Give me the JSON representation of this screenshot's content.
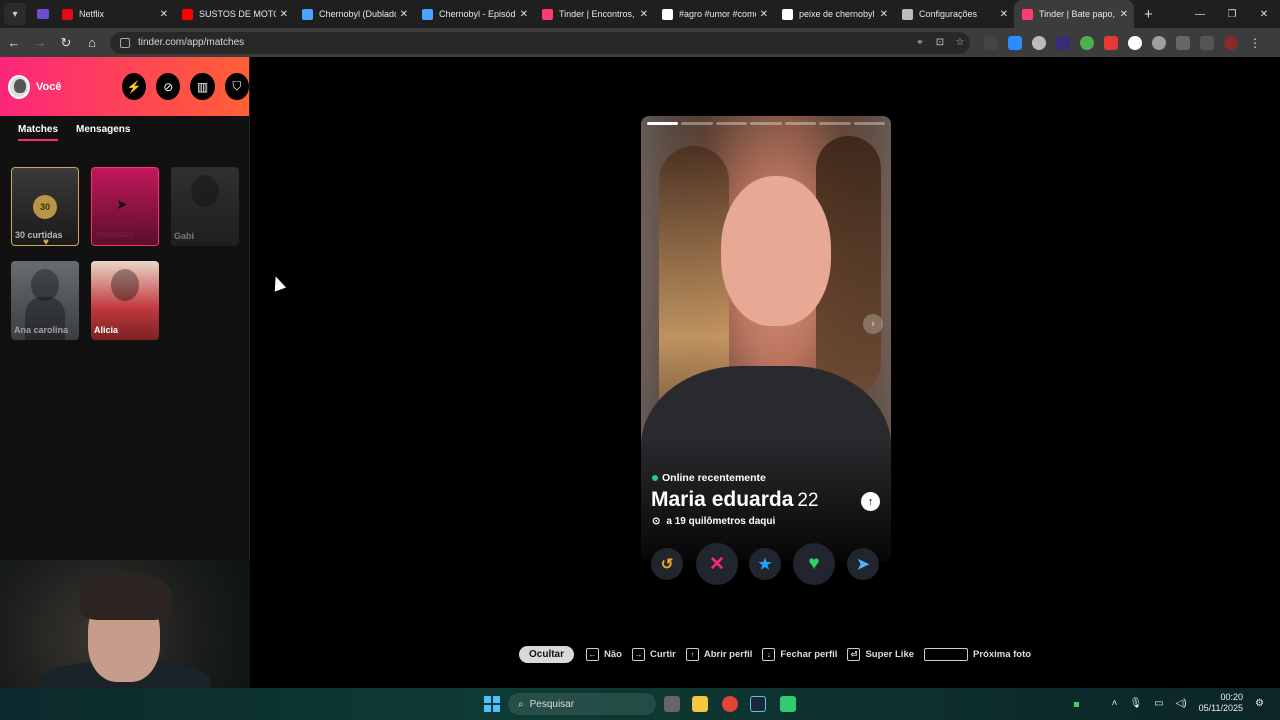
{
  "browser": {
    "tabs": [
      {
        "title": "Netflix",
        "favicon_color": "#e50914",
        "active": false
      },
      {
        "title": "SUSTOS DE MOTO (",
        "favicon_color": "#ff0000",
        "active": false
      },
      {
        "title": "Chernobyl (Dublado",
        "favicon_color": "#4aa3ff",
        "active": false
      },
      {
        "title": "Chernobyl - Episódio",
        "favicon_color": "#4aa3ff",
        "active": false
      },
      {
        "title": "Tinder | Encontros, A",
        "favicon_color": "#fe3c72",
        "active": false
      },
      {
        "title": "#agro #umor #come",
        "favicon_color": "#ffffff",
        "active": false
      },
      {
        "title": "peixe de chernobyl",
        "favicon_color": "#ffffff",
        "active": false
      },
      {
        "title": "Configurações",
        "favicon_color": "#bbbbbb",
        "active": false
      },
      {
        "title": "Tinder | Bate papo, /",
        "favicon_color": "#fe3c72",
        "active": true
      }
    ],
    "url": "tinder.com/app/matches"
  },
  "sidebar": {
    "profile_label": "Você",
    "tabs": [
      {
        "label": "Matches",
        "active": true
      },
      {
        "label": "Mensagens",
        "active": false
      }
    ],
    "likes_card": {
      "count": "30",
      "label": "30 curtidas"
    },
    "sent_card": {
      "label": "Curtidas enviadas"
    },
    "matches": [
      {
        "name": "Gabi"
      },
      {
        "name": "Ana carolina"
      },
      {
        "name": "Alicia"
      }
    ]
  },
  "profile_card": {
    "status": "Online recentemente",
    "name": "Maria eduarda",
    "age": "22",
    "distance": "a 19 quilômetros daqui",
    "photo_count": 7,
    "current_photo": 1
  },
  "actions": {
    "rewind_icon": "rewind-icon",
    "nope_icon": "close-icon",
    "superlike_icon": "star-icon",
    "like_icon": "heart-icon",
    "boost_icon": "send-icon"
  },
  "shortcuts": {
    "hide_label": "Ocultar",
    "items": [
      {
        "key": "←",
        "label": "Não"
      },
      {
        "key": "→",
        "label": "Curtir"
      },
      {
        "key": "↑",
        "label": "Abrir perfil"
      },
      {
        "key": "↓",
        "label": "Fechar perfil"
      },
      {
        "key": "⏎",
        "label": "Super Like"
      },
      {
        "key": "",
        "label": "Próxima foto"
      }
    ]
  },
  "taskbar": {
    "search_label": "Pesquisar",
    "time": "00:20",
    "date": "05/11/2025"
  },
  "colors": {
    "brand_gradient_start": "#fd267a",
    "brand_gradient_end": "#ff6036",
    "nope": "#ff2a6d",
    "superlike": "#1fa3ff",
    "like": "#2bd46a",
    "rewind": "#f5a623",
    "boost": "#4eb8ff"
  }
}
